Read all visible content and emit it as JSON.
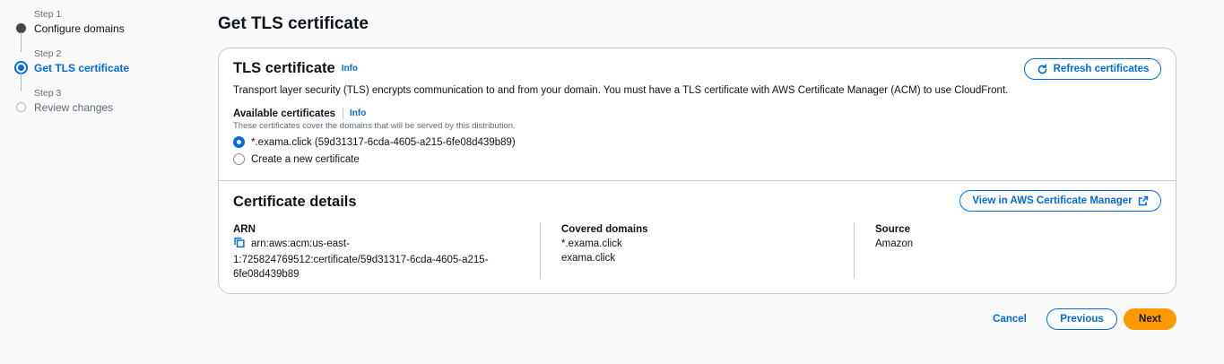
{
  "steps": [
    {
      "small": "Step 1",
      "title": "Configure domains",
      "state": "done"
    },
    {
      "small": "Step 2",
      "title": "Get TLS certificate",
      "state": "active"
    },
    {
      "small": "Step 3",
      "title": "Review changes",
      "state": "todo"
    }
  ],
  "page_title": "Get TLS certificate",
  "tls": {
    "heading": "TLS certificate",
    "info": "Info",
    "refresh_button": "Refresh certificates",
    "description": "Transport layer security (TLS) encrypts communication to and from your domain. You must have a TLS certificate with AWS Certificate Manager (ACM) to use CloudFront.",
    "available_label": "Available certificates",
    "available_info": "Info",
    "available_desc": "These certificates cover the domains that will be served by this distribution.",
    "options": [
      {
        "label": "*.exama.click (59d31317-6cda-4605-a215-6fe08d439b89)",
        "checked": true
      },
      {
        "label": "Create a new certificate",
        "checked": false
      }
    ]
  },
  "details": {
    "heading": "Certificate details",
    "view_button": "View in AWS Certificate Manager",
    "arn_label": "ARN",
    "arn_line1": "arn:aws:acm:us-east-",
    "arn_line2": "1:725824769512:certificate/59d31317-6cda-4605-a215-",
    "arn_line3": "6fe08d439b89",
    "covered_label": "Covered domains",
    "covered": [
      "*.exama.click",
      "exama.click"
    ],
    "source_label": "Source",
    "source_value": "Amazon"
  },
  "footer": {
    "cancel": "Cancel",
    "previous": "Previous",
    "next": "Next"
  },
  "colors": {
    "accent": "#006ce0",
    "primary_button": "#ff9900",
    "background": "#f9f9fa"
  }
}
